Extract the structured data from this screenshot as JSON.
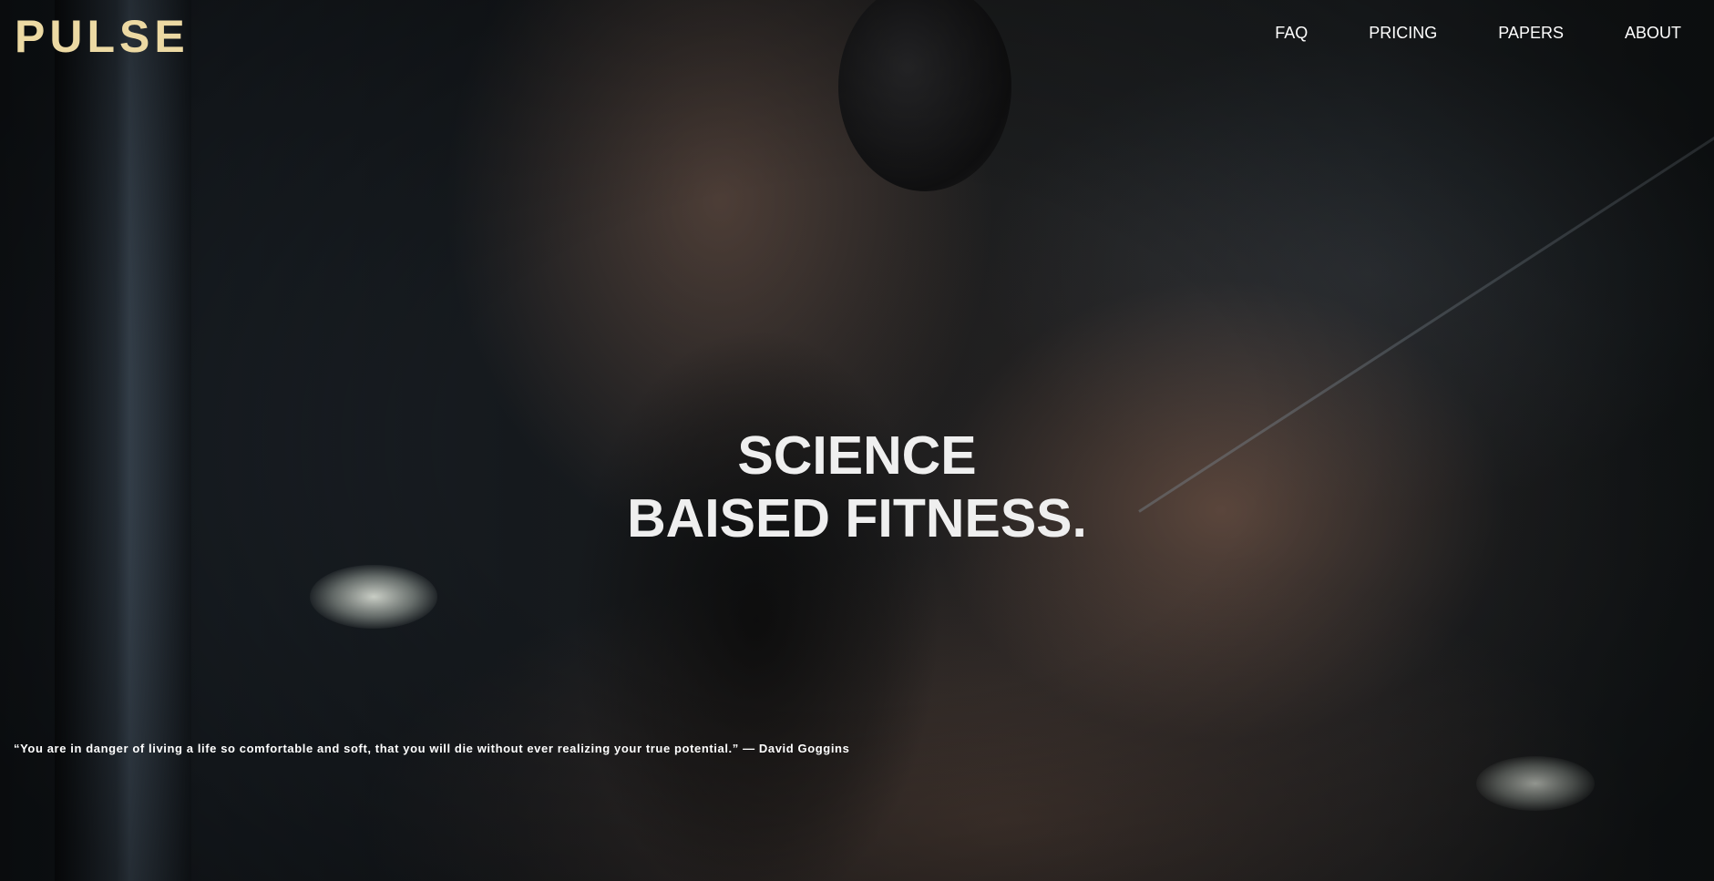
{
  "brand": {
    "logo_text": "PULSE",
    "logo_color": "#ecd9a3"
  },
  "nav": {
    "items": [
      {
        "label": "FAQ"
      },
      {
        "label": "PRICING"
      },
      {
        "label": "PAPERS"
      },
      {
        "label": "ABOUT"
      }
    ]
  },
  "hero": {
    "headline_line1": "SCIENCE",
    "headline_line2": "BAISED FITNESS.",
    "background_image": "gym-athlete-photo",
    "quote": "“You are in danger of living a life so comfortable and soft, that you will die without ever realizing your true potential.” — David Goggins"
  },
  "colors": {
    "text": "#ffffff",
    "headline": "#efefef",
    "accent": "#ecd9a3"
  }
}
